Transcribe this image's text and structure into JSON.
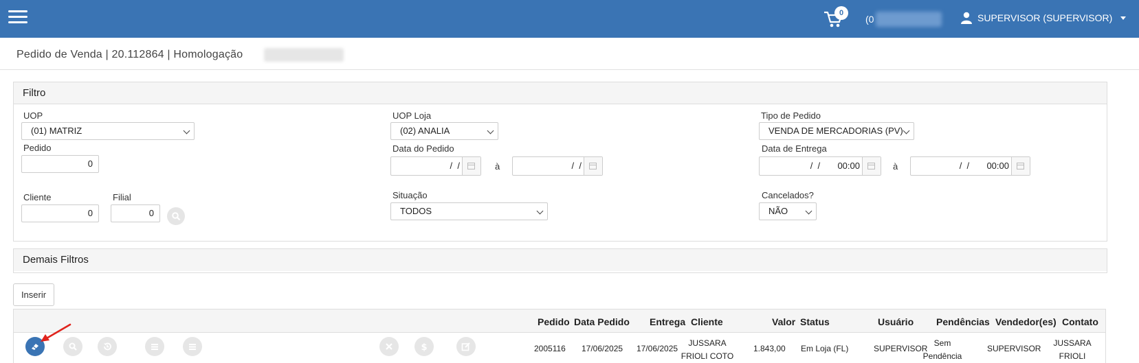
{
  "navbar": {
    "cart_count": "0",
    "code_prefix": "(0",
    "user_label": "SUPERVISOR (SUPERVISOR)"
  },
  "page": {
    "title": "Pedido de Venda | 20.112864 | Homologação"
  },
  "filtro": {
    "heading": "Filtro",
    "uop": {
      "label": "UOP",
      "value": "(01) MATRIZ"
    },
    "uop_loja": {
      "label": "UOP Loja",
      "value": "(02) ANALIA"
    },
    "tipo_pedido": {
      "label": "Tipo de Pedido",
      "value": "VENDA DE MERCADORIAS (PV)"
    },
    "pedido": {
      "label": "Pedido",
      "value": "0"
    },
    "data_pedido": {
      "label": "Data do Pedido",
      "from": "  /  /",
      "sep": "à",
      "to": "  /  /"
    },
    "data_entrega": {
      "label": "Data de Entrega",
      "from": "  /  /       00:00",
      "sep": "à",
      "to": "  /  /       00:00"
    },
    "cliente": {
      "label": "Cliente",
      "value": "0"
    },
    "filial": {
      "label": "Filial",
      "value": "0"
    },
    "situacao": {
      "label": "Situação",
      "value": "TODOS"
    },
    "cancelados": {
      "label": "Cancelados?",
      "value": "NÃO"
    }
  },
  "demais_filtros": {
    "heading": "Demais Filtros"
  },
  "actions": {
    "inserir_label": "Inserir"
  },
  "table": {
    "headers": {
      "pedido": "Pedido",
      "data_pedido": "Data Pedido",
      "entrega": "Entrega",
      "cliente": "Cliente",
      "valor": "Valor",
      "status": "Status",
      "usuario": "Usuário",
      "pendencias": "Pendências",
      "vendedores": "Vendedor(es)",
      "contato": "Contato"
    },
    "rows": [
      {
        "pedido": "2005116",
        "data_pedido": "17/06/2025",
        "entrega": "17/06/2025",
        "cliente": "JUSSARA FRIOLI COTO",
        "valor": "1.843,00",
        "status": "Em Loja (FL)",
        "usuario": "SUPERVISOR",
        "pendencias": "Sem Pendência",
        "vendedores": "SUPERVISOR",
        "contato": "JUSSARA FRIOLI"
      }
    ]
  },
  "colors": {
    "navbar": "#3a74b4",
    "panel_header": "#f5f5f5",
    "arrow": "#e0231c"
  }
}
